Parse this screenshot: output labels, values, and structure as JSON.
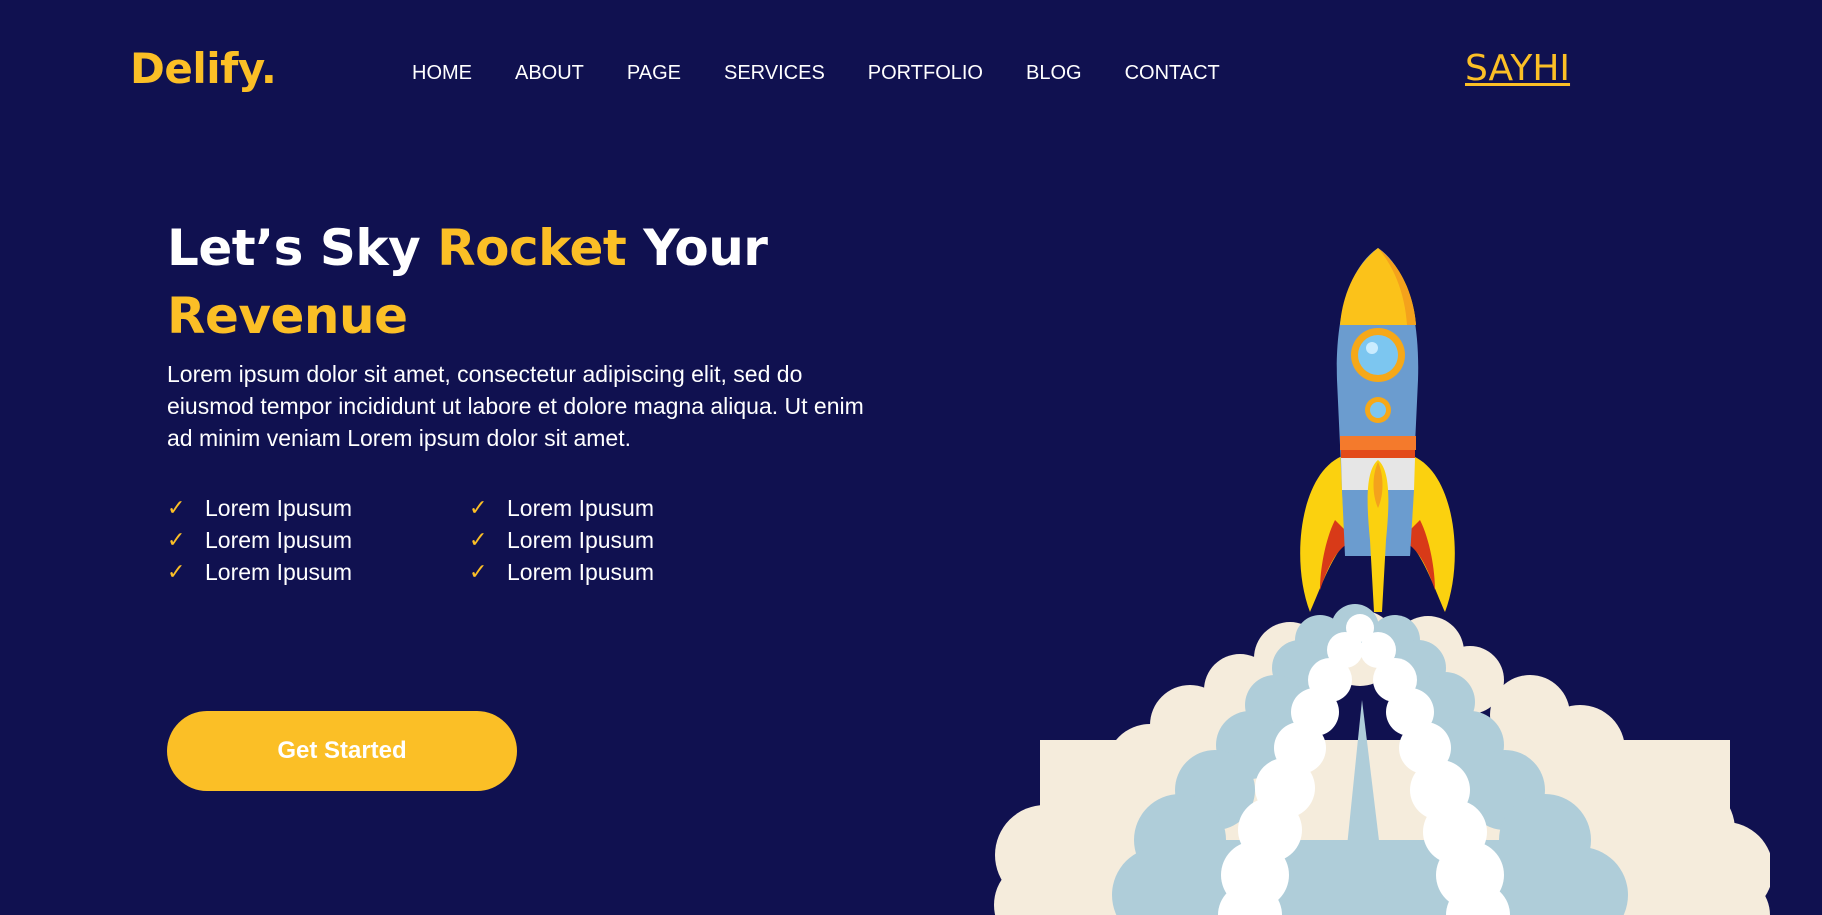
{
  "header": {
    "logo": "Delify.",
    "nav": [
      {
        "label": "HOME"
      },
      {
        "label": "ABOUT"
      },
      {
        "label": "PAGE"
      },
      {
        "label": "SERVICES"
      },
      {
        "label": "PORTFOLIO"
      },
      {
        "label": "BLOG"
      },
      {
        "label": "CONTACT"
      }
    ],
    "cta_link": "SAYHI"
  },
  "hero": {
    "title_part1": "Let’s Sky ",
    "title_accent1": "Rocket",
    "title_part2": " Your",
    "title_accent2": "Revenue",
    "description": "Lorem ipsum dolor sit amet, consectetur adipiscing elit, sed do eiusmod tempor incididunt ut labore et dolore magna aliqua. Ut enim ad minim veniam Lorem ipsum dolor sit amet.",
    "check_icon": "✓",
    "features": [
      "Lorem Ipusum",
      "Lorem Ipusum",
      "Lorem Ipusum",
      "Lorem Ipusum",
      "Lorem Ipusum",
      "Lorem Ipusum"
    ],
    "button_label": "Get Started"
  },
  "colors": {
    "background": "#101150",
    "accent": "#fbbf26",
    "text": "#ffffff"
  },
  "illustration": {
    "icon": "rocket-launch-illustration"
  }
}
